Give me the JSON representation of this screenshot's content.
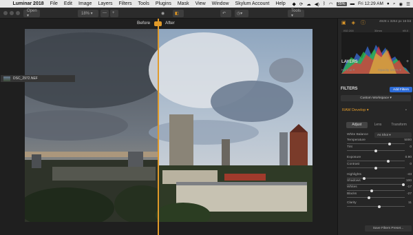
{
  "menubar": {
    "apple": "",
    "items": [
      "Luminar 2018",
      "File",
      "Edit",
      "Image",
      "Layers",
      "Filters",
      "Tools",
      "Plugins",
      "Mask",
      "View",
      "Window",
      "Skylum Account",
      "Help"
    ],
    "battery": "35%",
    "clock": "Fri 12:29 AM"
  },
  "toolbar": {
    "open_label": "Open ▾",
    "zoom_label": "18% ▾",
    "zoom_minus": "—",
    "zoom_plus": "+",
    "tools_label": "Tools ▾"
  },
  "compare": {
    "before": "Before",
    "after": "After"
  },
  "panel": {
    "file_info": "4928 x 3264 px   16-bit",
    "exif": [
      "ISO 200",
      "30mm",
      "f/8.0"
    ],
    "layers_title": "LAYERS",
    "blend_mode": "Normal ▾",
    "opacity": "Opacity 100% ▾",
    "layer_name": "DSC_2972.NEF",
    "filters_title": "FILTERS",
    "add_filters": "Add Filters",
    "workspace": "Custom Workspace ▾",
    "raw_develop": "RAW Develop ▾",
    "subtabs": [
      "Adjust",
      "Lens",
      "Transform"
    ],
    "white_balance_label": "White Balance",
    "white_balance_value": "As Shot ▾",
    "sliders": [
      {
        "label": "Temperature",
        "value": "5000",
        "pos": 0.75
      },
      {
        "label": "Tint",
        "value": "0",
        "pos": 0.5
      },
      {
        "label": "Exposure",
        "value": "0.90",
        "pos": 0.72
      },
      {
        "label": "Contrast",
        "value": "0",
        "pos": 0.5
      },
      {
        "label": "Highlights",
        "value": "-43",
        "pos": 0.29
      },
      {
        "label": "Shadows",
        "value": "100",
        "pos": 1.0
      },
      {
        "label": "Whites",
        "value": "-17",
        "pos": 0.42
      },
      {
        "label": "Blacks",
        "value": "-27",
        "pos": 0.37
      },
      {
        "label": "Clarity",
        "value": "11",
        "pos": 0.56
      }
    ],
    "save_preset": "Save Filters Preset..."
  }
}
